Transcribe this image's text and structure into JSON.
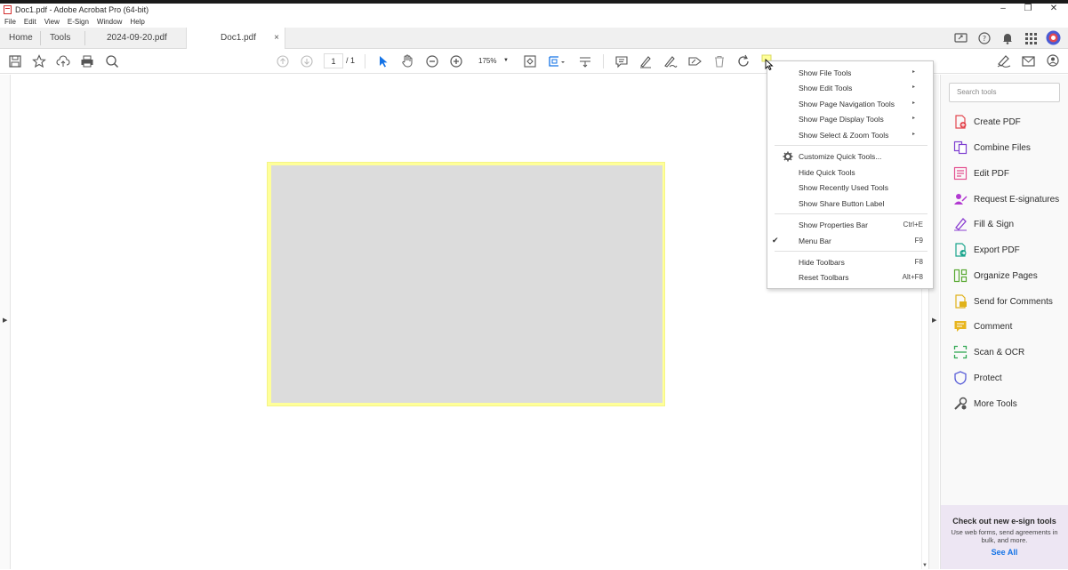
{
  "window": {
    "title": "Doc1.pdf - Adobe Acrobat Pro (64-bit)",
    "minimize": "–",
    "maximize": "❐",
    "close": "✕"
  },
  "menubar": [
    "File",
    "Edit",
    "View",
    "E-Sign",
    "Window",
    "Help"
  ],
  "tabs": {
    "home": "Home",
    "tools": "Tools",
    "doc1": "2024-09-20.pdf",
    "doc2": "Doc1.pdf",
    "close": "×"
  },
  "toolbar": {
    "page_current": "1",
    "page_total": "/ 1",
    "zoom": "175%"
  },
  "search_tools": {
    "placeholder": "Search tools"
  },
  "tools": [
    {
      "label": "Create PDF",
      "icon": "create-pdf-icon",
      "color": "#e34850"
    },
    {
      "label": "Combine Files",
      "icon": "combine-files-icon",
      "color": "#7e3fd1"
    },
    {
      "label": "Edit PDF",
      "icon": "edit-pdf-icon",
      "color": "#e34f8f"
    },
    {
      "label": "Request E-signatures",
      "icon": "request-esignatures-icon",
      "color": "#b23ad1"
    },
    {
      "label": "Fill & Sign",
      "icon": "fill-sign-icon",
      "color": "#8b3fd1"
    },
    {
      "label": "Export PDF",
      "icon": "export-pdf-icon",
      "color": "#1ba58d"
    },
    {
      "label": "Organize Pages",
      "icon": "organize-pages-icon",
      "color": "#58a831"
    },
    {
      "label": "Send for Comments",
      "icon": "send-for-comments-icon",
      "color": "#e0b21a"
    },
    {
      "label": "Comment",
      "icon": "comment-icon",
      "color": "#e8b620"
    },
    {
      "label": "Scan & OCR",
      "icon": "scan-ocr-icon",
      "color": "#31a853"
    },
    {
      "label": "Protect",
      "icon": "protect-icon",
      "color": "#5a5fd8"
    },
    {
      "label": "More Tools",
      "icon": "more-tools-icon",
      "color": "#555555"
    }
  ],
  "promo": {
    "title": "Check out new e-sign tools",
    "text": "Use web forms, send agreements in bulk, and more.",
    "link": "See All"
  },
  "context_menu": {
    "items": [
      {
        "label": "Show File Tools",
        "submenu": "▸"
      },
      {
        "label": "Show Edit Tools",
        "submenu": "▸"
      },
      {
        "label": "Show Page Navigation Tools",
        "submenu": "▸"
      },
      {
        "label": "Show Page Display Tools",
        "submenu": "▸"
      },
      {
        "label": "Show Select & Zoom Tools",
        "submenu": "▸"
      },
      {
        "label": "Customize Quick Tools..."
      },
      {
        "label": "Hide Quick Tools"
      },
      {
        "label": "Show Recently Used Tools"
      },
      {
        "label": "Show Share Button Label"
      },
      {
        "label": "Show Properties Bar",
        "shortcut": "Ctrl+E"
      },
      {
        "label": "Menu Bar",
        "shortcut": "F9",
        "checked": "✔"
      },
      {
        "label": "Hide Toolbars",
        "shortcut": "F8"
      },
      {
        "label": "Reset Toolbars",
        "shortcut": "Alt+F8"
      }
    ]
  },
  "colors": {
    "accent": "#1473e6",
    "page_highlight": "#ffff99",
    "page_fill": "#dcdcdc"
  }
}
